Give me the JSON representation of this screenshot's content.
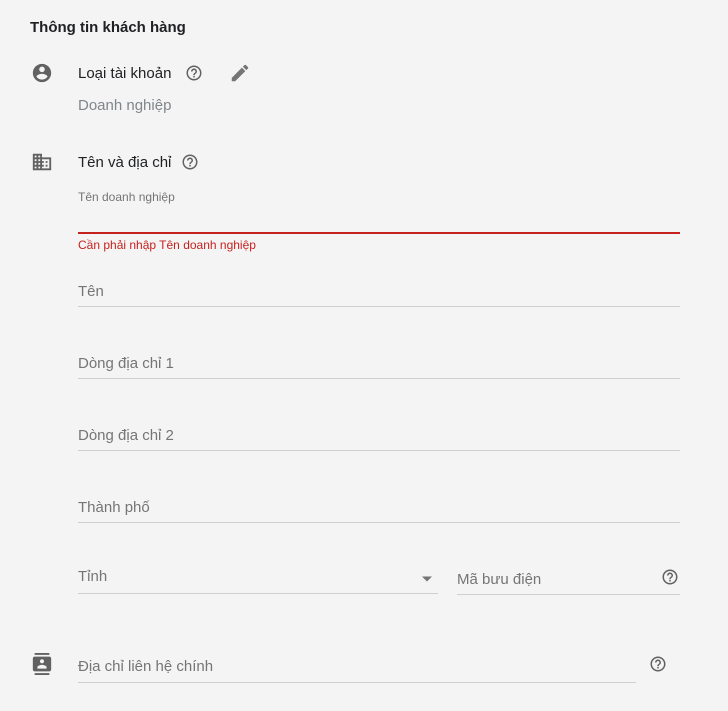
{
  "section": {
    "title": "Thông tin khách hàng"
  },
  "account_type": {
    "label": "Loại tài khoản",
    "value": "Doanh nghiệp"
  },
  "name_address": {
    "label": "Tên và địa chỉ",
    "business_name": {
      "label": "Tên doanh nghiệp",
      "value": "",
      "error": "Cần phải nhập Tên doanh nghiệp"
    },
    "name": {
      "placeholder": "Tên",
      "value": ""
    },
    "address_line_1": {
      "placeholder": "Dòng địa chỉ 1",
      "value": ""
    },
    "address_line_2": {
      "placeholder": "Dòng địa chỉ 2",
      "value": ""
    },
    "city": {
      "placeholder": "Thành phố",
      "value": ""
    },
    "province": {
      "placeholder": "Tỉnh",
      "selected": ""
    },
    "postal_code": {
      "placeholder": "Mã bưu điện",
      "value": ""
    }
  },
  "primary_contact": {
    "placeholder": "Địa chỉ liên hệ chính",
    "value": ""
  },
  "colors": {
    "error": "#c5221f",
    "icon": "#757575",
    "background": "#f4f4f4"
  }
}
